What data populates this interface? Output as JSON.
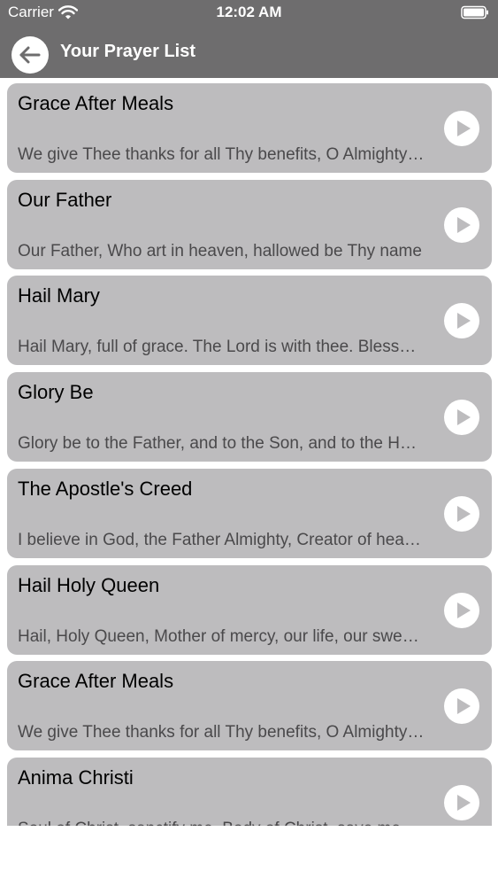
{
  "status_bar": {
    "carrier": "Carrier",
    "time": "12:02 AM",
    "wifi_icon": "wifi-icon",
    "battery_icon": "battery-icon"
  },
  "nav": {
    "title": "Your Prayer List",
    "back_icon": "arrow-left-icon"
  },
  "colors": {
    "header_bg": "#6e6d6e",
    "card_bg": "#bdbcbe",
    "subtitle": "#4a494b",
    "play_icon": "#ffffff"
  },
  "prayers": [
    {
      "title": "Grace After Meals",
      "preview": "We give Thee thanks for all Thy benefits, O Almighty God"
    },
    {
      "title": "Our Father",
      "preview": "Our Father, Who art in heaven, hallowed be Thy name"
    },
    {
      "title": "Hail Mary",
      "preview": "Hail Mary, full of grace. The Lord is with thee. Blessed art thou"
    },
    {
      "title": "Glory Be",
      "preview": "Glory be to the Father, and to the Son, and to the Holy Spirit"
    },
    {
      "title": "The Apostle's Creed",
      "preview": "I believe in God, the Father Almighty, Creator of heaven and earth"
    },
    {
      "title": "Hail Holy Queen",
      "preview": "Hail, Holy Queen, Mother of mercy, our life, our sweetness and our hope"
    },
    {
      "title": "Grace After Meals",
      "preview": "We give Thee thanks for all Thy benefits, O Almighty God"
    },
    {
      "title": "Anima Christi",
      "preview": "Soul of Christ, sanctify me. Body of Christ, save me"
    }
  ]
}
